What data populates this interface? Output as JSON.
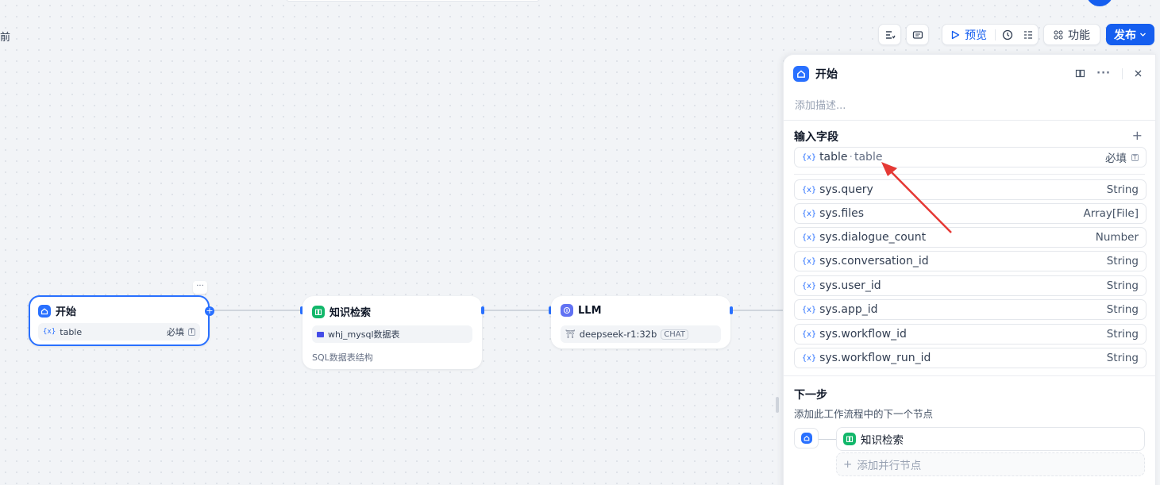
{
  "canvas": {
    "prev_text": "前"
  },
  "toolbar": {
    "preview_label": "预览",
    "features_label": "功能",
    "publish_label": "发布"
  },
  "nodes": {
    "start": {
      "title": "开始",
      "var": "table",
      "required": "必填",
      "more": "···"
    },
    "knowledge": {
      "title": "知识检索",
      "dataset": "whj_mysql数据表",
      "desc": "SQL数据表结构"
    },
    "llm": {
      "title": "LLM",
      "model": "deepseek-r1:32b",
      "mode": "CHAT"
    }
  },
  "panel": {
    "title": "开始",
    "description_placeholder": "添加描述...",
    "input_section_title": "输入字段",
    "add_symbol": "+",
    "user_field": {
      "name": "table",
      "sep": "·",
      "label": "table",
      "required": "必填"
    },
    "sys_fields": [
      {
        "name": "sys.query",
        "type": "String"
      },
      {
        "name": "sys.files",
        "type": "Array[File]"
      },
      {
        "name": "sys.dialogue_count",
        "type": "Number"
      },
      {
        "name": "sys.conversation_id",
        "type": "String"
      },
      {
        "name": "sys.user_id",
        "type": "String"
      },
      {
        "name": "sys.app_id",
        "type": "String"
      },
      {
        "name": "sys.workflow_id",
        "type": "String"
      },
      {
        "name": "sys.workflow_run_id",
        "type": "String"
      }
    ],
    "next_step": {
      "title": "下一步",
      "description": "添加此工作流程中的下一个节点",
      "next_node": "知识检索",
      "add_parallel": "添加并行节点"
    }
  },
  "colors": {
    "accent": "#155eef",
    "arrow": "#e53935"
  }
}
